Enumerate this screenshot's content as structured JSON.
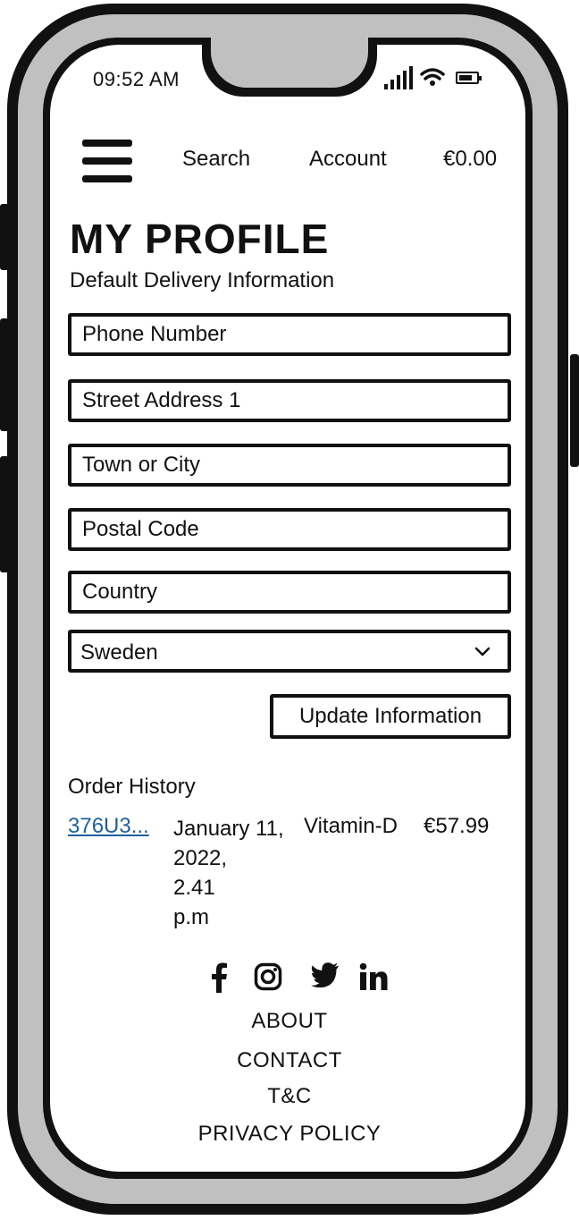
{
  "status_bar": {
    "time": "09:52 AM"
  },
  "header": {
    "search_label": "Search",
    "account_label": "Account",
    "cart_total": "€0.00"
  },
  "profile": {
    "title": "MY PROFILE",
    "subtitle": "Default Delivery Information",
    "fields": {
      "phone_placeholder": "Phone Number",
      "street_placeholder": "Street Address 1",
      "town_placeholder": "Town or City",
      "postal_placeholder": "Postal Code",
      "country_placeholder": "Country"
    },
    "country_select_value": "Sweden",
    "update_button": "Update Information"
  },
  "order_history": {
    "title": "Order History",
    "orders": [
      {
        "id": "376U3...",
        "date_lines": [
          "January 11,",
          "2022,",
          "2.41",
          "p.m"
        ],
        "product": "Vitamin-D",
        "total": "€57.99"
      }
    ]
  },
  "footer": {
    "social_icons": [
      "facebook-icon",
      "instagram-icon",
      "twitter-icon",
      "linkedin-icon"
    ],
    "links": [
      "ABOUT",
      "CONTACT",
      "T&C",
      "PRIVACY POLICY"
    ]
  }
}
